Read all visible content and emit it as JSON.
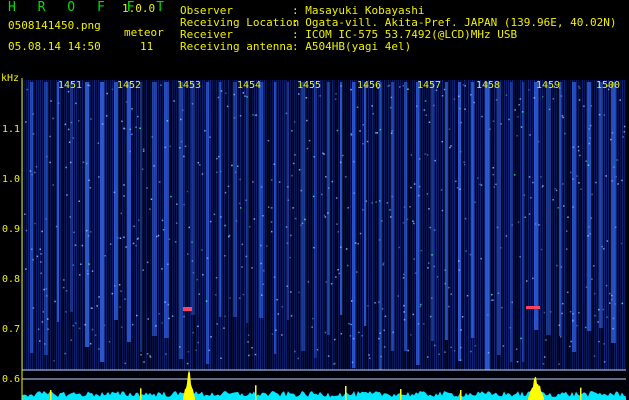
{
  "app": {
    "name": "H R O F F T",
    "version": "1.0.0"
  },
  "file": {
    "name": "0508141450.png",
    "datetime": "05.08.14 14:50"
  },
  "meteor": {
    "label": "meteor",
    "count": "11"
  },
  "info": [
    {
      "key": "Observer",
      "value": ": Masayuki Kobayashi"
    },
    {
      "key": "Receiving Location",
      "value": ": Ogata-vill. Akita-Pref. JAPAN (139.96E, 40.02N)"
    },
    {
      "key": "Receiver",
      "value": ": ICOM IC-575 53.7492(@LCD)MHz USB"
    },
    {
      "key": "Receiving antenna",
      "value": ": A504HB(yagi 4el)"
    }
  ],
  "y_axis": {
    "unit": "kHz",
    "ticks": [
      "1.1",
      "1.0",
      "0.9",
      "0.8",
      "0.7",
      "0.6"
    ]
  },
  "minutes": [
    "1451",
    "1452",
    "1453",
    "1454",
    "1455",
    "1456",
    "1457",
    "1458",
    "1459",
    "1500"
  ],
  "colors": {
    "text": "#f0f000",
    "brand": "#00e000",
    "noise": "#1840c8",
    "line": "#c0d8ff",
    "echo": "#ff4060",
    "level": "#00e8ff",
    "peak": "#ffff00"
  }
}
